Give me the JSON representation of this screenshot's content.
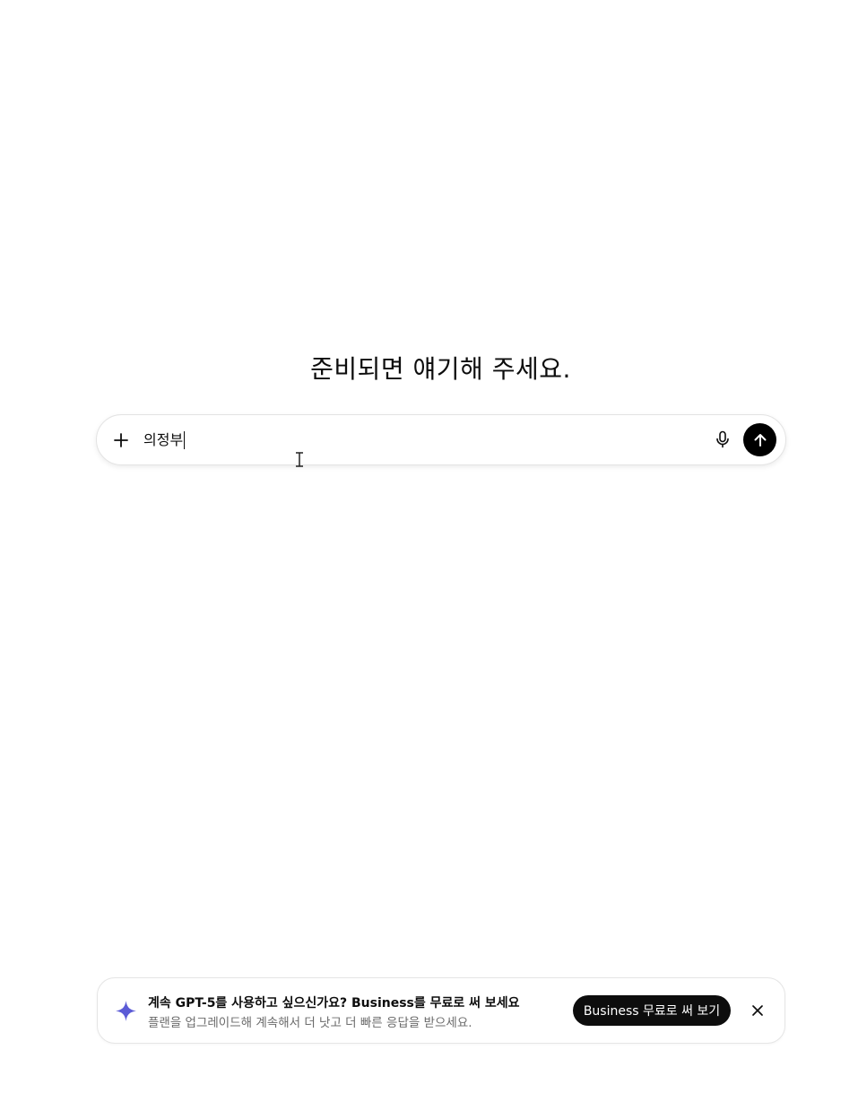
{
  "main": {
    "heading": "준비되면 얘기해 주세요."
  },
  "composer": {
    "input_value": "의정부",
    "icons": {
      "add": "plus-icon",
      "voice": "microphone-icon",
      "send": "arrow-up-icon"
    }
  },
  "banner": {
    "title": "계속 GPT-5를 사용하고 싶으신가요? Business를 무료로 써 보세요",
    "subtitle": "플랜을 업그레이드해 계속해서 더 낫고 더 빠른 응답을 받으세요.",
    "cta_label": "Business 무료로 써 보기",
    "icon": "sparkle-icon",
    "accent_color": "#5b5bd6"
  }
}
